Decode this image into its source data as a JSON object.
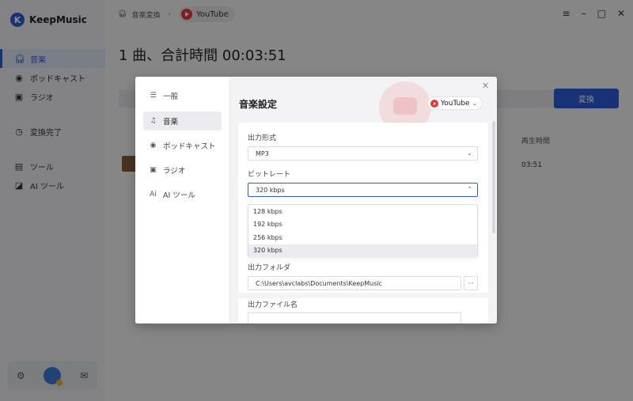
{
  "app": {
    "name": "KeepMusic",
    "logo_letter": "K"
  },
  "sidebar": {
    "items": [
      {
        "label": "音楽",
        "icon": "headphones-icon"
      },
      {
        "label": "ポッドキャスト",
        "icon": "podcast-icon"
      },
      {
        "label": "ラジオ",
        "icon": "radio-icon"
      },
      {
        "label": "変換完了",
        "icon": "clock-icon"
      },
      {
        "label": "ツール",
        "icon": "toolbox-icon"
      },
      {
        "label": "AI ツール",
        "icon": "ai-icon"
      }
    ]
  },
  "topbar": {
    "breadcrumb_music": "音楽変換",
    "breadcrumb_source": "YouTube"
  },
  "main": {
    "title": "1 曲、合計時間 00:03:51",
    "convert_label": "変換",
    "column_duration": "再生時間",
    "row_duration": "03:51"
  },
  "dialog": {
    "nav": [
      {
        "label": "一般",
        "icon": "sliders-icon"
      },
      {
        "label": "音楽",
        "icon": "music-note-icon"
      },
      {
        "label": "ポッドキャスト",
        "icon": "podcast-icon"
      },
      {
        "label": "ラジオ",
        "icon": "radio-icon"
      },
      {
        "label": "AI ツール",
        "icon": "ai-icon"
      }
    ],
    "title": "音楽設定",
    "source_select": "YouTube",
    "output_format_label": "出力形式",
    "output_format_value": "MP3",
    "bitrate_label": "ビットレート",
    "bitrate_value": "320 kbps",
    "bitrate_options": [
      "128 kbps",
      "192 kbps",
      "256 kbps",
      "320 kbps"
    ],
    "output_folder_label": "出力フォルダ",
    "output_folder_value": "C:\\Users\\avclabs\\Documents\\KeepMusic",
    "output_filename_label": "出力ファイル名",
    "browse_label": "···"
  },
  "colors": {
    "accent": "#2a5bd7",
    "youtube": "#e53935"
  }
}
